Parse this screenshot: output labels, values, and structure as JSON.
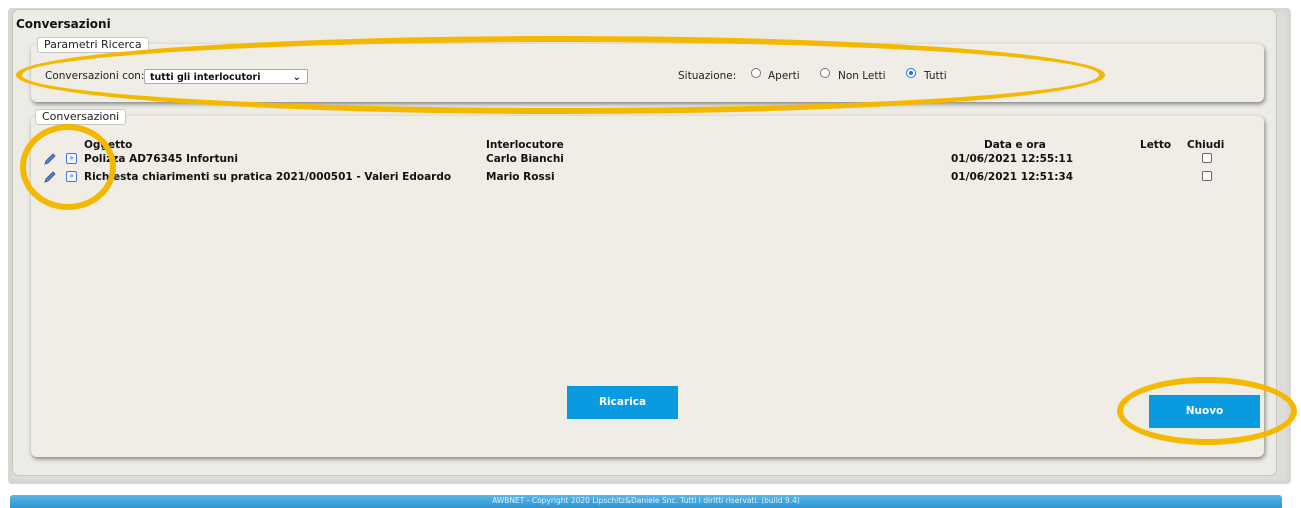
{
  "page_title": "Conversazioni",
  "search_params": {
    "legend": "Parametri Ricerca",
    "conversations_with_label": "Conversazioni con:",
    "conversations_with_value": "tutti gli interlocutori",
    "situation_label": "Situazione:",
    "options": [
      {
        "label": "Aperti",
        "checked": false
      },
      {
        "label": "Non Letti",
        "checked": false
      },
      {
        "label": "Tutti",
        "checked": true
      }
    ]
  },
  "conversations": {
    "legend": "Conversazioni",
    "columns": [
      "Oggetto",
      "Interlocutore",
      "Data e ora",
      "Letto",
      "Chiudi"
    ],
    "rows": [
      {
        "subject": "Polizza AD76345 Infortuni",
        "contact": "Carlo Bianchi",
        "datetime": "01/06/2021 12:55:11",
        "closed": false
      },
      {
        "subject": "Richiesta chiarimenti su pratica 2021/000501 - Valeri Edoardo",
        "contact": "Mario Rossi",
        "datetime": "01/06/2021 12:51:34",
        "closed": false
      }
    ]
  },
  "buttons": {
    "reload": "Ricarica",
    "new": "Nuovo"
  },
  "footer": "AWBNET - Copyright 2020 Lipschitz&Daniele Snc. Tutti i diritti riservati. (build 9.4)",
  "colors": {
    "accent": "#0a9ae0",
    "highlight": "#f5b800",
    "panel": "#ecebe6"
  }
}
